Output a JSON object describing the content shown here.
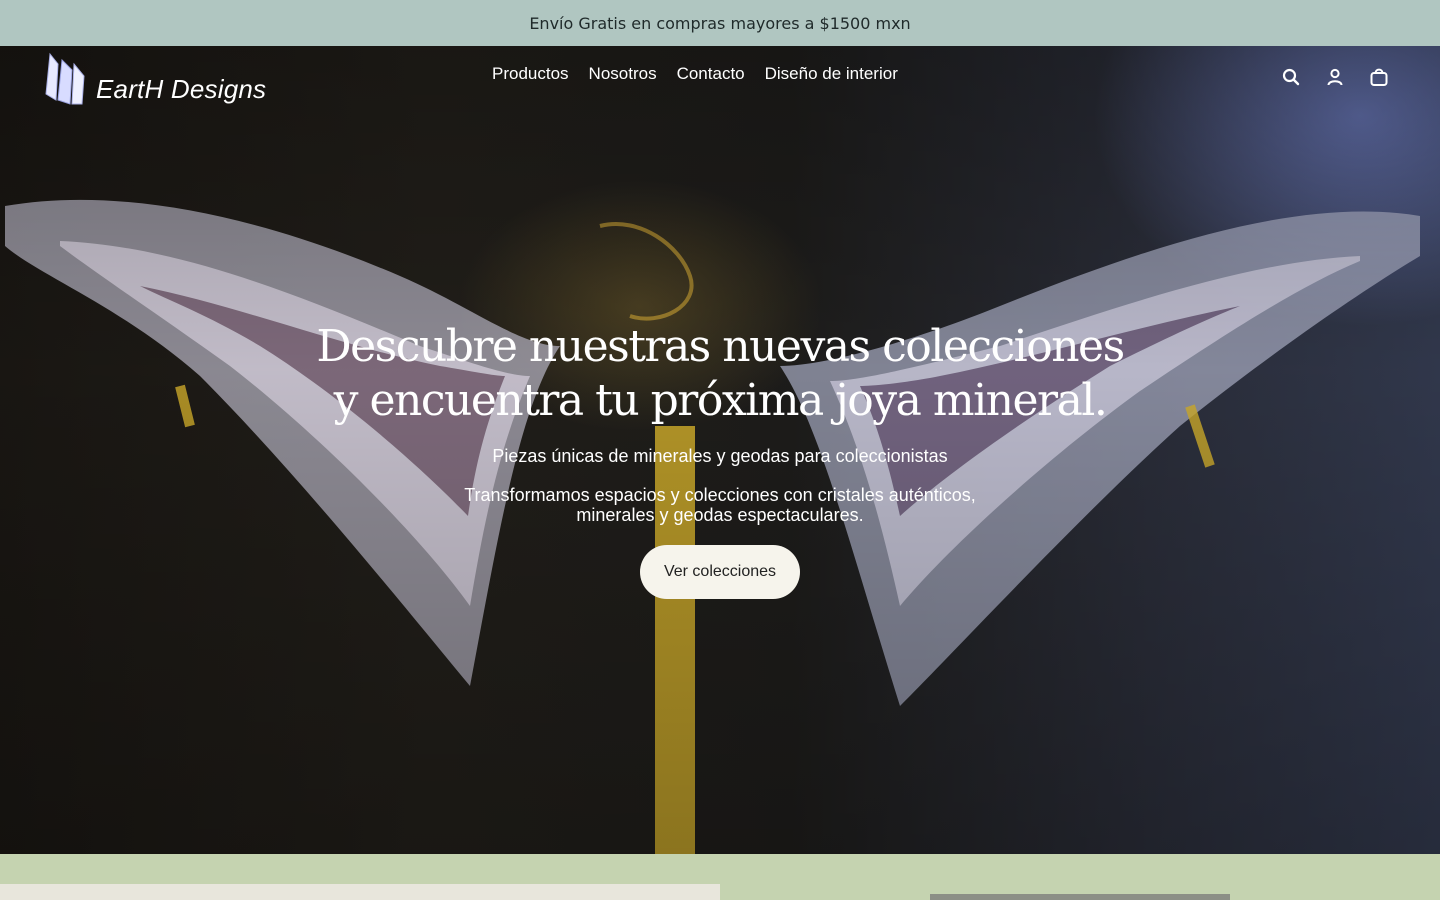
{
  "announcement": {
    "text": "Envío Gratis en compras mayores a $1500 mxn"
  },
  "header": {
    "logo_text": "EartH Designs",
    "nav": [
      {
        "label": "Productos"
      },
      {
        "label": "Nosotros"
      },
      {
        "label": "Contacto"
      },
      {
        "label": "Diseño de interior"
      }
    ],
    "icons": [
      "search-icon",
      "account-icon",
      "cart-icon"
    ]
  },
  "hero": {
    "title": "Descubre nuestras nuevas colecciones\ny encuentra tu próxima joya mineral.",
    "subtitle": "Piezas únicas de minerales y geodas para coleccionistas",
    "description": "Transformamos espacios y colecciones con cristales auténticos, minerales y geodas espectaculares.",
    "cta_label": "Ver colecciones"
  },
  "colors": {
    "announcement_bg": "#b0c6c1",
    "section_bg": "#c5d3b0",
    "cta_bg": "#f6f4ec"
  }
}
